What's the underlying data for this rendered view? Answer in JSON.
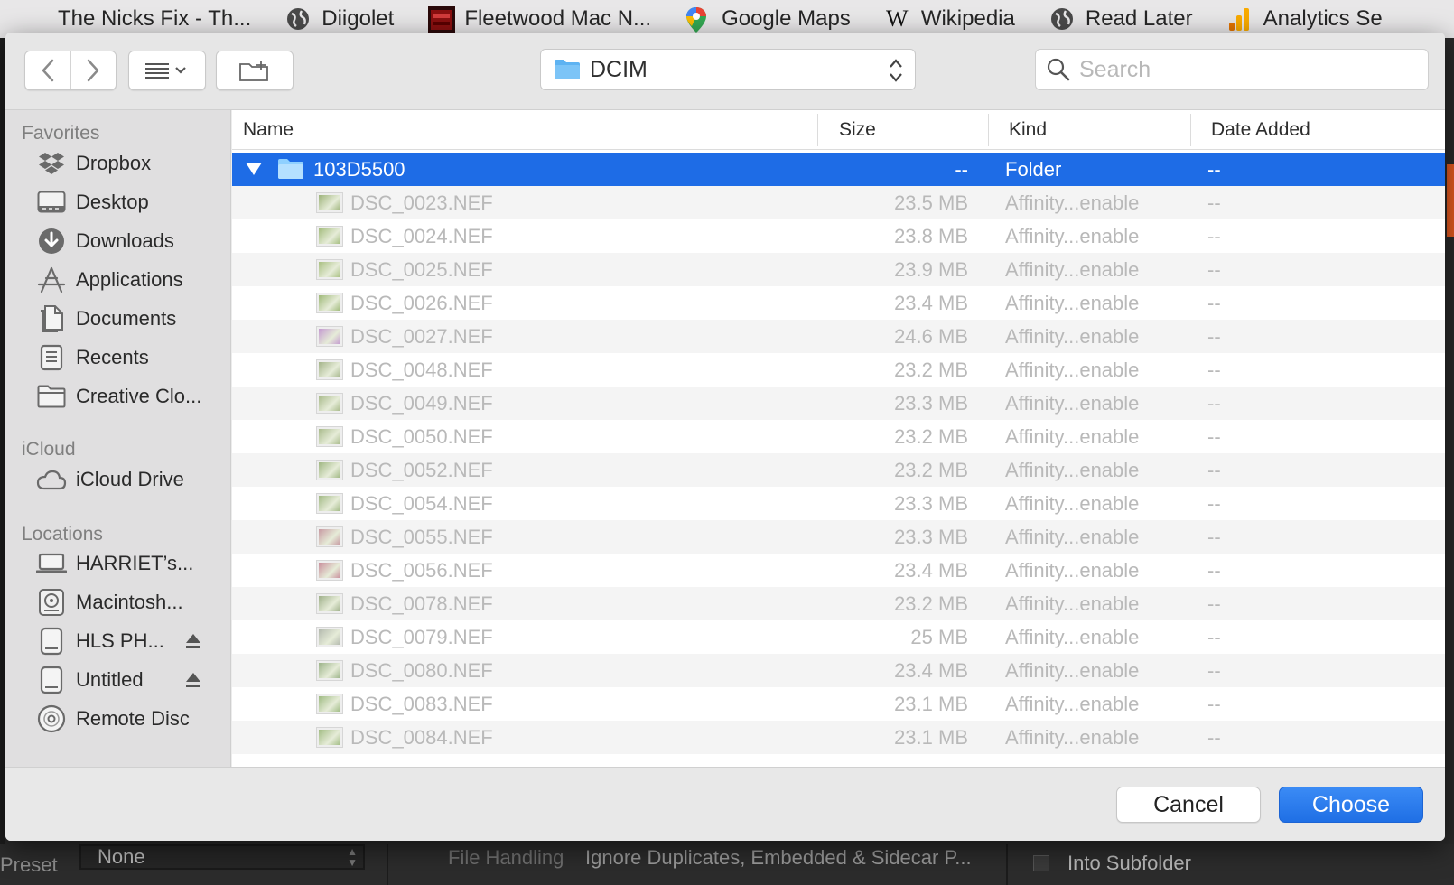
{
  "bookmarks": [
    {
      "label": "The Nicks Fix - Th...",
      "icon": "nicks-fix-icon"
    },
    {
      "label": "Diigolet",
      "icon": "globe-icon"
    },
    {
      "label": "Fleetwood Mac N...",
      "icon": "fleetwood-mac-icon"
    },
    {
      "label": "Google Maps",
      "icon": "google-maps-pin-icon"
    },
    {
      "label": "Wikipedia",
      "icon": "wikipedia-w-icon"
    },
    {
      "label": "Read Later",
      "icon": "globe-icon"
    },
    {
      "label": "Analytics Se",
      "icon": "analytics-bars-icon"
    }
  ],
  "toolbar": {
    "path_label": "DCIM",
    "search_placeholder": "Search"
  },
  "sidebar": {
    "favorites_heading": "Favorites",
    "favorites": [
      {
        "label": "Dropbox",
        "icon": "dropbox-icon"
      },
      {
        "label": "Desktop",
        "icon": "desktop-icon"
      },
      {
        "label": "Downloads",
        "icon": "downloads-icon"
      },
      {
        "label": "Applications",
        "icon": "applications-icon"
      },
      {
        "label": "Documents",
        "icon": "documents-icon"
      },
      {
        "label": "Recents",
        "icon": "recents-icon"
      },
      {
        "label": "Creative Clo...",
        "icon": "folder-icon"
      }
    ],
    "icloud_heading": "iCloud",
    "icloud": [
      {
        "label": "iCloud Drive",
        "icon": "cloud-icon"
      }
    ],
    "locations_heading": "Locations",
    "locations": [
      {
        "label": "HARRIET’s...",
        "icon": "laptop-icon"
      },
      {
        "label": "Macintosh...",
        "icon": "hard-drive-icon"
      },
      {
        "label": "HLS PH...",
        "icon": "external-drive-icon",
        "eject": true
      },
      {
        "label": "Untitled",
        "icon": "external-drive-icon",
        "eject": true
      },
      {
        "label": "Remote Disc",
        "icon": "disc-icon"
      }
    ]
  },
  "columns": {
    "name": "Name",
    "size": "Size",
    "kind": "Kind",
    "date": "Date Added"
  },
  "selected_folder": {
    "name": "103D5500",
    "size": "--",
    "kind": "Folder",
    "date": "--"
  },
  "files": [
    {
      "name": "DSC_0023.NEF",
      "size": "23.5 MB",
      "kind": "Affinity...enable",
      "date": "--",
      "tint": "#9db37a"
    },
    {
      "name": "DSC_0024.NEF",
      "size": "23.8 MB",
      "kind": "Affinity...enable",
      "date": "--",
      "tint": "#a4bd7e"
    },
    {
      "name": "DSC_0025.NEF",
      "size": "23.9 MB",
      "kind": "Affinity...enable",
      "date": "--",
      "tint": "#a9c082"
    },
    {
      "name": "DSC_0026.NEF",
      "size": "23.4 MB",
      "kind": "Affinity...enable",
      "date": "--",
      "tint": "#9fb979"
    },
    {
      "name": "DSC_0027.NEF",
      "size": "24.6 MB",
      "kind": "Affinity...enable",
      "date": "--",
      "tint": "#c49ad0"
    },
    {
      "name": "DSC_0048.NEF",
      "size": "23.2 MB",
      "kind": "Affinity...enable",
      "date": "--",
      "tint": "#a4b48a"
    },
    {
      "name": "DSC_0049.NEF",
      "size": "23.3 MB",
      "kind": "Affinity...enable",
      "date": "--",
      "tint": "#a8ba8a"
    },
    {
      "name": "DSC_0050.NEF",
      "size": "23.2 MB",
      "kind": "Affinity...enable",
      "date": "--",
      "tint": "#a9bb8c"
    },
    {
      "name": "DSC_0052.NEF",
      "size": "23.2 MB",
      "kind": "Affinity...enable",
      "date": "--",
      "tint": "#9fb682"
    },
    {
      "name": "DSC_0054.NEF",
      "size": "23.3 MB",
      "kind": "Affinity...enable",
      "date": "--",
      "tint": "#a2b985"
    },
    {
      "name": "DSC_0055.NEF",
      "size": "23.3 MB",
      "kind": "Affinity...enable",
      "date": "--",
      "tint": "#c79aa2"
    },
    {
      "name": "DSC_0056.NEF",
      "size": "23.4 MB",
      "kind": "Affinity...enable",
      "date": "--",
      "tint": "#c98f9c"
    },
    {
      "name": "DSC_0078.NEF",
      "size": "23.2 MB",
      "kind": "Affinity...enable",
      "date": "--",
      "tint": "#9fb08a"
    },
    {
      "name": "DSC_0079.NEF",
      "size": "25 MB",
      "kind": "Affinity...enable",
      "date": "--",
      "tint": "#b3b9ae"
    },
    {
      "name": "DSC_0080.NEF",
      "size": "23.4 MB",
      "kind": "Affinity...enable",
      "date": "--",
      "tint": "#9cb389"
    },
    {
      "name": "DSC_0083.NEF",
      "size": "23.1 MB",
      "kind": "Affinity...enable",
      "date": "--",
      "tint": "#9fbb83"
    },
    {
      "name": "DSC_0084.NEF",
      "size": "23.1 MB",
      "kind": "Affinity...enable",
      "date": "--",
      "tint": "#a2bc84"
    }
  ],
  "footer": {
    "cancel_label": "Cancel",
    "choose_label": "Choose"
  },
  "lightroom_bar": {
    "preset_label": "Preset",
    "preset_value": "None",
    "file_handling_label": "File Handling",
    "file_handling_value": "Ignore Duplicates, Embedded & Sidecar P...",
    "subfolder_label": "Into Subfolder"
  },
  "colors": {
    "selection": "#1e6ce6",
    "folder": "#5eb3f2",
    "accent": "#1f6fe5"
  }
}
